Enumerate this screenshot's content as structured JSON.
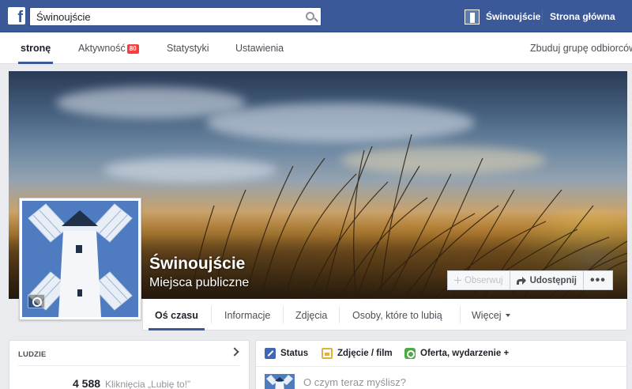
{
  "header": {
    "search_value": "Świnoujście",
    "user_name": "Świnoujście",
    "home_label": "Strona główna"
  },
  "admin_tabs": {
    "page": "stronę",
    "activity": "Aktywność",
    "activity_badge": "80",
    "insights": "Statystyki",
    "settings": "Ustawienia",
    "build_audience": "Zbuduj grupę odbiorców"
  },
  "page": {
    "name": "Świnoujście",
    "category": "Miejsca publiczne"
  },
  "cover_buttons": {
    "follow": "Obserwuj",
    "share": "Udostępnij",
    "more": "•••"
  },
  "timeline_tabs": {
    "timeline": "Oś czasu",
    "about": "Informacje",
    "photos": "Zdjęcia",
    "likes": "Osoby, które to lubią",
    "more": "Więcej"
  },
  "people_card": {
    "heading": "LUDZIE",
    "likes_count": "4 588",
    "likes_label": "Kliknięcia „Lubię to!”"
  },
  "composer": {
    "status": "Status",
    "photo_video": "Zdjęcie / film",
    "offer_event": "Oferta, wydarzenie +",
    "placeholder": "O czym teraz myślisz?"
  },
  "colors": {
    "brand": "#3b5998",
    "badge": "#fa3e3e"
  }
}
